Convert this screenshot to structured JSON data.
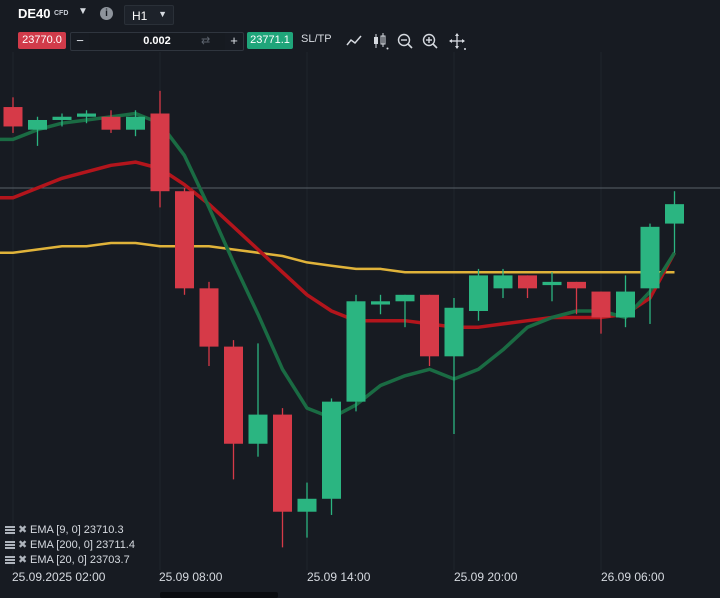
{
  "header": {
    "symbol": "DE40",
    "instrument_type": "CFD",
    "info_icon": "info-icon",
    "timeframe": "H1"
  },
  "trade_bar": {
    "sell_price": "23770.0",
    "quantity": "0.002",
    "minus_label": "−",
    "plus_label": "+",
    "buy_price": "23771.1",
    "sltp_label": "SL/TP",
    "tools": [
      "line-chart-icon",
      "candlestick-icon",
      "zoom-out-icon",
      "zoom-in-icon",
      "crosshair-move-icon"
    ]
  },
  "colors": {
    "background": "#171b22",
    "bull": "#2bb581",
    "bear": "#d63a48",
    "ema9": "#1a6b43",
    "ema20": "#b3151c",
    "ema200": "#e0b33a"
  },
  "indicators": [
    {
      "label": "EMA [9, 0] 23710.3"
    },
    {
      "label": "EMA [200, 0] 23711.4"
    },
    {
      "label": "EMA [20, 0] 23703.7"
    }
  ],
  "time_axis": [
    "25.09.2025 02:00",
    "25.09 08:00",
    "25.09 14:00",
    "25.09 20:00",
    "26.09 06:00"
  ],
  "chart_data": {
    "type": "candlestick",
    "interval": "H1",
    "candles": [
      {
        "o": 23748,
        "h": 23751,
        "l": 23740,
        "c": 23742
      },
      {
        "o": 23741,
        "h": 23745,
        "l": 23736,
        "c": 23744
      },
      {
        "o": 23744,
        "h": 23746,
        "l": 23742,
        "c": 23745
      },
      {
        "o": 23745,
        "h": 23747,
        "l": 23743,
        "c": 23746
      },
      {
        "o": 23745,
        "h": 23747,
        "l": 23740,
        "c": 23741
      },
      {
        "o": 23741,
        "h": 23747,
        "l": 23739,
        "c": 23745
      },
      {
        "o": 23746,
        "h": 23753,
        "l": 23717,
        "c": 23722
      },
      {
        "o": 23722,
        "h": 23723,
        "l": 23690,
        "c": 23692
      },
      {
        "o": 23692,
        "h": 23694,
        "l": 23668,
        "c": 23674
      },
      {
        "o": 23674,
        "h": 23676,
        "l": 23633,
        "c": 23644
      },
      {
        "o": 23644,
        "h": 23675,
        "l": 23640,
        "c": 23653
      },
      {
        "o": 23653,
        "h": 23655,
        "l": 23612,
        "c": 23623
      },
      {
        "o": 23623,
        "h": 23632,
        "l": 23615,
        "c": 23627
      },
      {
        "o": 23627,
        "h": 23658,
        "l": 23622,
        "c": 23657
      },
      {
        "o": 23657,
        "h": 23690,
        "l": 23654,
        "c": 23688
      },
      {
        "o": 23687,
        "h": 23690,
        "l": 23684,
        "c": 23688
      },
      {
        "o": 23688,
        "h": 23690,
        "l": 23680,
        "c": 23690
      },
      {
        "o": 23690,
        "h": 23690,
        "l": 23668,
        "c": 23671
      },
      {
        "o": 23671,
        "h": 23689,
        "l": 23647,
        "c": 23686
      },
      {
        "o": 23685,
        "h": 23698,
        "l": 23682,
        "c": 23696
      },
      {
        "o": 23692,
        "h": 23698,
        "l": 23689,
        "c": 23696
      },
      {
        "o": 23696,
        "h": 23696,
        "l": 23689,
        "c": 23692
      },
      {
        "o": 23693,
        "h": 23697,
        "l": 23688,
        "c": 23694
      },
      {
        "o": 23694,
        "h": 23694,
        "l": 23684,
        "c": 23692
      },
      {
        "o": 23691,
        "h": 23691,
        "l": 23678,
        "c": 23683
      },
      {
        "o": 23683,
        "h": 23696,
        "l": 23680,
        "c": 23691
      },
      {
        "o": 23692,
        "h": 23712,
        "l": 23681,
        "c": 23711
      },
      {
        "o": 23712,
        "h": 23722,
        "l": 23703,
        "c": 23718
      }
    ],
    "series": [
      {
        "name": "EMA [9, 0]",
        "color": "#1a6b43",
        "values": [
          23738,
          23741,
          23743,
          23744,
          23745,
          23746,
          23743,
          23733,
          23717,
          23700,
          23684,
          23667,
          23655,
          23652,
          23656,
          23662,
          23665,
          23667,
          23664,
          23667,
          23673,
          23680,
          23683,
          23685,
          23685,
          23683,
          23691,
          23703
        ]
      },
      {
        "name": "EMA [20, 0]",
        "color": "#b3151c",
        "values": [
          23720,
          23723,
          23726,
          23728,
          23730,
          23731,
          23729,
          23724,
          23718,
          23711,
          23704,
          23697,
          23690,
          23685,
          23682,
          23682,
          23682,
          23681,
          23680,
          23680,
          23681,
          23682,
          23683,
          23683,
          23683,
          23684,
          23689,
          23703
        ]
      },
      {
        "name": "EMA [200, 0]",
        "color": "#e0b33a",
        "values": [
          23703,
          23704,
          23705,
          23705,
          23706,
          23706,
          23705,
          23705,
          23705,
          23704,
          23703,
          23702,
          23700,
          23699,
          23698,
          23698,
          23697,
          23697,
          23697,
          23697,
          23697,
          23697,
          23697,
          23697,
          23697,
          23697,
          23697,
          23697
        ]
      }
    ],
    "last_price_line": 23723,
    "y_range": [
      23605,
      23765
    ]
  }
}
